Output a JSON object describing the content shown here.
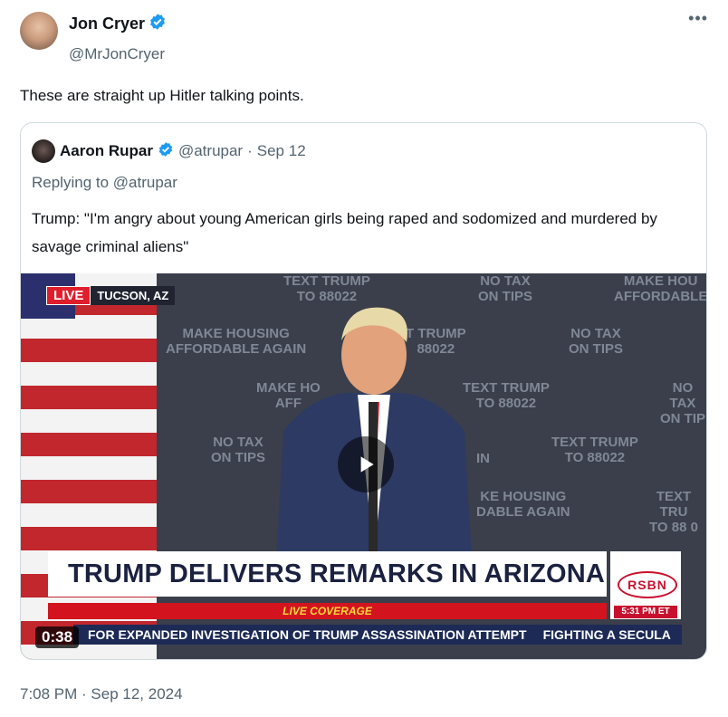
{
  "author": {
    "name": "Jon Cryer",
    "handle": "@MrJonCryer"
  },
  "tweet": {
    "text": "These are straight up Hitler talking points.",
    "timestamp": "7:08 PM · Sep 12, 2024"
  },
  "more_icon": "more-horizontal-icon",
  "quoted": {
    "name": "Aaron Rupar",
    "handle": "@atrupar",
    "separator": "·",
    "date": "Sep 12",
    "replying_to": "Replying to @atrupar",
    "text": "Trump: \"I'm angry about young American girls being raped and sodomized and murdered by savage criminal aliens\""
  },
  "video": {
    "live_label": "LIVE",
    "location": "TUCSON, AZ",
    "headline": "TRUMP DELIVERS REMARKS IN ARIZONA",
    "coverage": "LIVE COVERAGE",
    "network": "RSBN",
    "network_time": "5:31 PM ET",
    "ticker_1": "FOR EXPANDED INVESTIGATION OF TRUMP ASSASSINATION ATTEMPT",
    "ticker_2": "FIGHTING A SECULA",
    "elapsed": "0:38",
    "backdrop": {
      "a1": "TEXT TRUMP",
      "a2": "TO 88022",
      "b1": "NO TAX",
      "b2": "ON TIPS",
      "c1": "MAKE HOU",
      "c2": "AFFORDABLE",
      "d1": "MAKE HOUSING",
      "d2": "AFFORDABLE AGAIN",
      "e1": "T TRUMP",
      "e2": "88022",
      "f1": "NO TAX",
      "f2": "ON TIPS",
      "g1": "MAKE HO",
      "g2": "AFF",
      "h1": "TEXT TRUMP",
      "h2": "TO 88022",
      "i1": "NO TAX",
      "i2": "ON TIP",
      "j1": "NO TAX",
      "j2": "ON TIPS",
      "k1": "TEXT TRUMP",
      "k2": "TO 88022",
      "l1": "IN",
      "m1": "KE HOUSING",
      "m2": "DABLE AGAIN",
      "n1": "TEXT TRU",
      "n2": "TO 88 0"
    }
  },
  "colors": {
    "verified": "#1d9bf0",
    "live_red": "#e01e2b",
    "ticker_navy": "#1d2a55",
    "muted_text": "#536471"
  }
}
